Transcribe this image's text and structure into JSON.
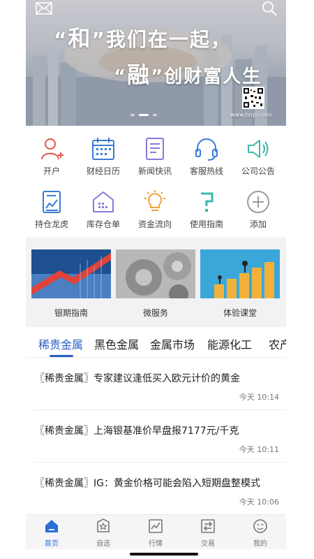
{
  "banner": {
    "line1_quote_open": "“",
    "line1_big": "和",
    "line1_quote_close": "”",
    "line1_rest": "我们在一起，",
    "line2_quote_open": "“",
    "line2_big": "融",
    "line2_quote_close": "”",
    "line2_rest": "创财富人生",
    "url": "www.hrqh.com",
    "icons": {
      "top_left": "mail-icon",
      "top_right": "search-icon"
    }
  },
  "grid": {
    "items": [
      {
        "label": "开户",
        "icon": "add-user-icon"
      },
      {
        "label": "财经日历",
        "icon": "calendar-icon"
      },
      {
        "label": "新闻快讯",
        "icon": "newspaper-icon"
      },
      {
        "label": "客服热线",
        "icon": "headset-icon"
      },
      {
        "label": "公司公告",
        "icon": "megaphone-icon"
      },
      {
        "label": "持仓龙虎",
        "icon": "chart-document-icon"
      },
      {
        "label": "库存仓单",
        "icon": "warehouse-icon"
      },
      {
        "label": "资金流向",
        "icon": "lightbulb-icon"
      },
      {
        "label": "使用指南",
        "icon": "question-icon"
      },
      {
        "label": "添加",
        "icon": "plus-circle-icon"
      }
    ]
  },
  "features": [
    {
      "label": "银期指南"
    },
    {
      "label": "微服务"
    },
    {
      "label": "体验课堂"
    }
  ],
  "tabs": [
    {
      "label": "稀贵金属",
      "active": true
    },
    {
      "label": "黑色金属"
    },
    {
      "label": "金属市场"
    },
    {
      "label": "能源化工"
    },
    {
      "label": "农产"
    }
  ],
  "news": [
    {
      "title": "〖稀贵金属〗专家建议逢低买入欧元计价的黄金",
      "time": "今天 10:14"
    },
    {
      "title": "〖稀贵金属〗上海银基准价早盘报7177元/千克",
      "time": "今天 10:11"
    },
    {
      "title": "〖稀贵金属〗IG：黄金价格可能会陷入短期盘整模式",
      "time": "今天 10:06"
    }
  ],
  "bottom_nav": [
    {
      "label": "首页",
      "icon": "home-icon",
      "active": true
    },
    {
      "label": "自选",
      "icon": "favorites-icon"
    },
    {
      "label": "行情",
      "icon": "market-chart-icon"
    },
    {
      "label": "交易",
      "icon": "trade-icon"
    },
    {
      "label": "我的",
      "icon": "profile-icon"
    }
  ],
  "colors": {
    "accent": "#2a5fc1",
    "nav_active": "#2a6ed6",
    "icon_red": "#e2574c",
    "icon_blue": "#3a7bd5",
    "icon_purple": "#8a78d8",
    "icon_teal": "#3bb9a8",
    "icon_orange": "#f0a23a",
    "icon_gray": "#9a9a9a"
  }
}
